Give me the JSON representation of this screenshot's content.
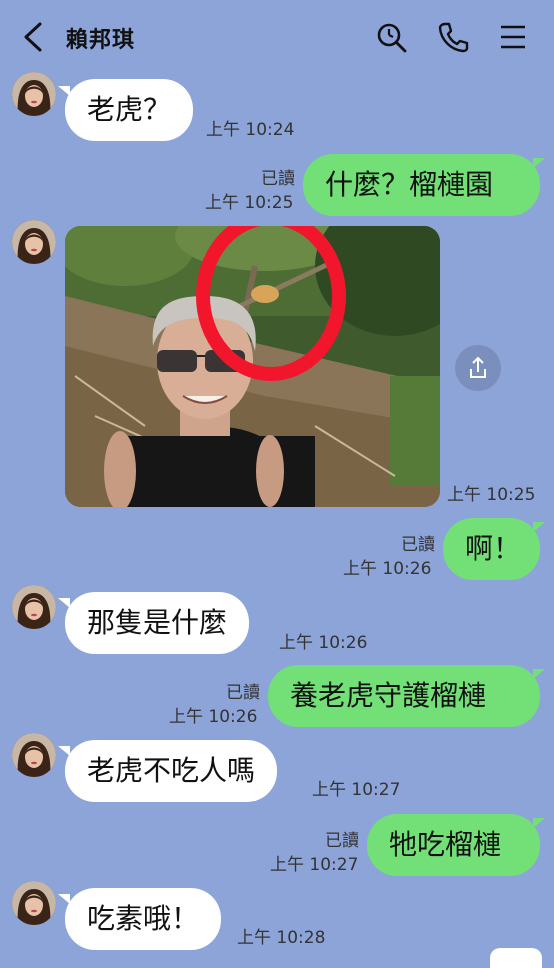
{
  "header": {
    "contact_name": "賴邦琪"
  },
  "messages": [
    {
      "side": "in",
      "text": "老虎？",
      "time": "上午 10:24"
    },
    {
      "side": "out",
      "text": "什麼？榴槤園",
      "read": "已讀",
      "time": "上午 10:25"
    },
    {
      "side": "in",
      "type": "photo",
      "time": "上午 10:25"
    },
    {
      "side": "out",
      "text": "啊！",
      "read": "已讀",
      "time": "上午 10:26"
    },
    {
      "side": "in",
      "text": "那隻是什麼",
      "time": "上午 10:26"
    },
    {
      "side": "out",
      "text": "養老虎守護榴槤",
      "read": "已讀",
      "time": "上午 10:26"
    },
    {
      "side": "in",
      "text": "老虎不吃人嗎",
      "time": "上午 10:27"
    },
    {
      "side": "out",
      "text": "牠吃榴槤",
      "read": "已讀",
      "time": "上午 10:27"
    },
    {
      "side": "in",
      "text": "吃素哦！",
      "time": "上午 10:28"
    }
  ],
  "icons": {
    "back": "chevron-left-icon",
    "search": "search-icon",
    "call": "phone-icon",
    "menu": "hamburger-menu-icon",
    "share": "share-icon"
  },
  "colors": {
    "background": "#8ca4d8",
    "outgoing_bubble": "#72e076",
    "incoming_bubble": "#ffffff",
    "annotation_circle": "#f2162c"
  }
}
